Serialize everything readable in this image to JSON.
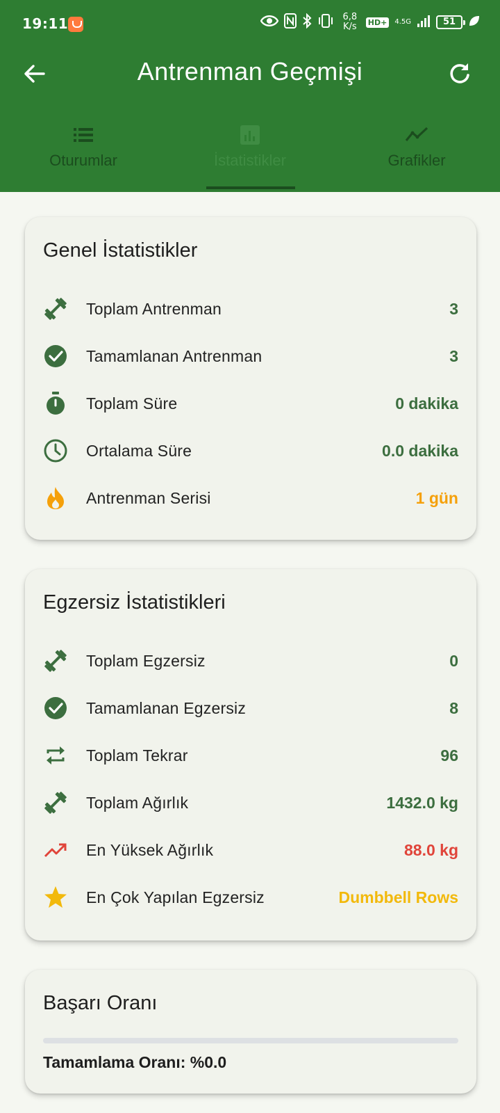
{
  "status_bar": {
    "time": "19:11",
    "speed_value": "6,8",
    "speed_unit": "K/s",
    "hd": "HD+",
    "network": "4.5G",
    "battery": "51"
  },
  "appbar": {
    "title": "Antrenman Geçmişi"
  },
  "tabs": [
    {
      "label": "Oturumlar",
      "icon": "list-icon",
      "active": false
    },
    {
      "label": "İstatistikler",
      "icon": "bar-chart-icon",
      "active": true
    },
    {
      "label": "Grafikler",
      "icon": "trending-line-icon",
      "active": false
    }
  ],
  "general": {
    "title": "Genel İstatistikler",
    "rows": [
      {
        "icon": "dumbbell-icon",
        "label": "Toplam Antrenman",
        "value": "3"
      },
      {
        "icon": "check-circle-icon",
        "label": "Tamamlanan Antrenman",
        "value": "3"
      },
      {
        "icon": "stopwatch-icon",
        "label": "Toplam Süre",
        "value": "0 dakika"
      },
      {
        "icon": "clock-icon",
        "label": "Ortalama Süre",
        "value": "0.0 dakika"
      },
      {
        "icon": "fire-icon",
        "label": "Antrenman Serisi",
        "value": "1 gün"
      }
    ]
  },
  "exercise": {
    "title": "Egzersiz İstatistikleri",
    "rows": [
      {
        "icon": "dumbbell-icon",
        "label": "Toplam Egzersiz",
        "value": "0"
      },
      {
        "icon": "check-circle-icon",
        "label": "Tamamlanan Egzersiz",
        "value": "8"
      },
      {
        "icon": "repeat-icon",
        "label": "Toplam Tekrar",
        "value": "96"
      },
      {
        "icon": "dumbbell-icon",
        "label": "Toplam Ağırlık",
        "value": "1432.0 kg"
      },
      {
        "icon": "trending-up-icon",
        "label": "En Yüksek Ağırlık",
        "value": "88.0 kg"
      },
      {
        "icon": "star-icon",
        "label": "En Çok Yapılan Egzersiz",
        "value": "Dumbbell Rows"
      }
    ]
  },
  "success": {
    "title": "Başarı Oranı",
    "progress": 0.0,
    "completion_text": "Tamamlama Oranı: %0.0"
  },
  "colors": {
    "primary": "#2e7d32",
    "value_green": "#3c6e3f",
    "streak_orange": "#f5a00a",
    "max_weight_red": "#e0443a",
    "star_yellow": "#f2b90c"
  }
}
